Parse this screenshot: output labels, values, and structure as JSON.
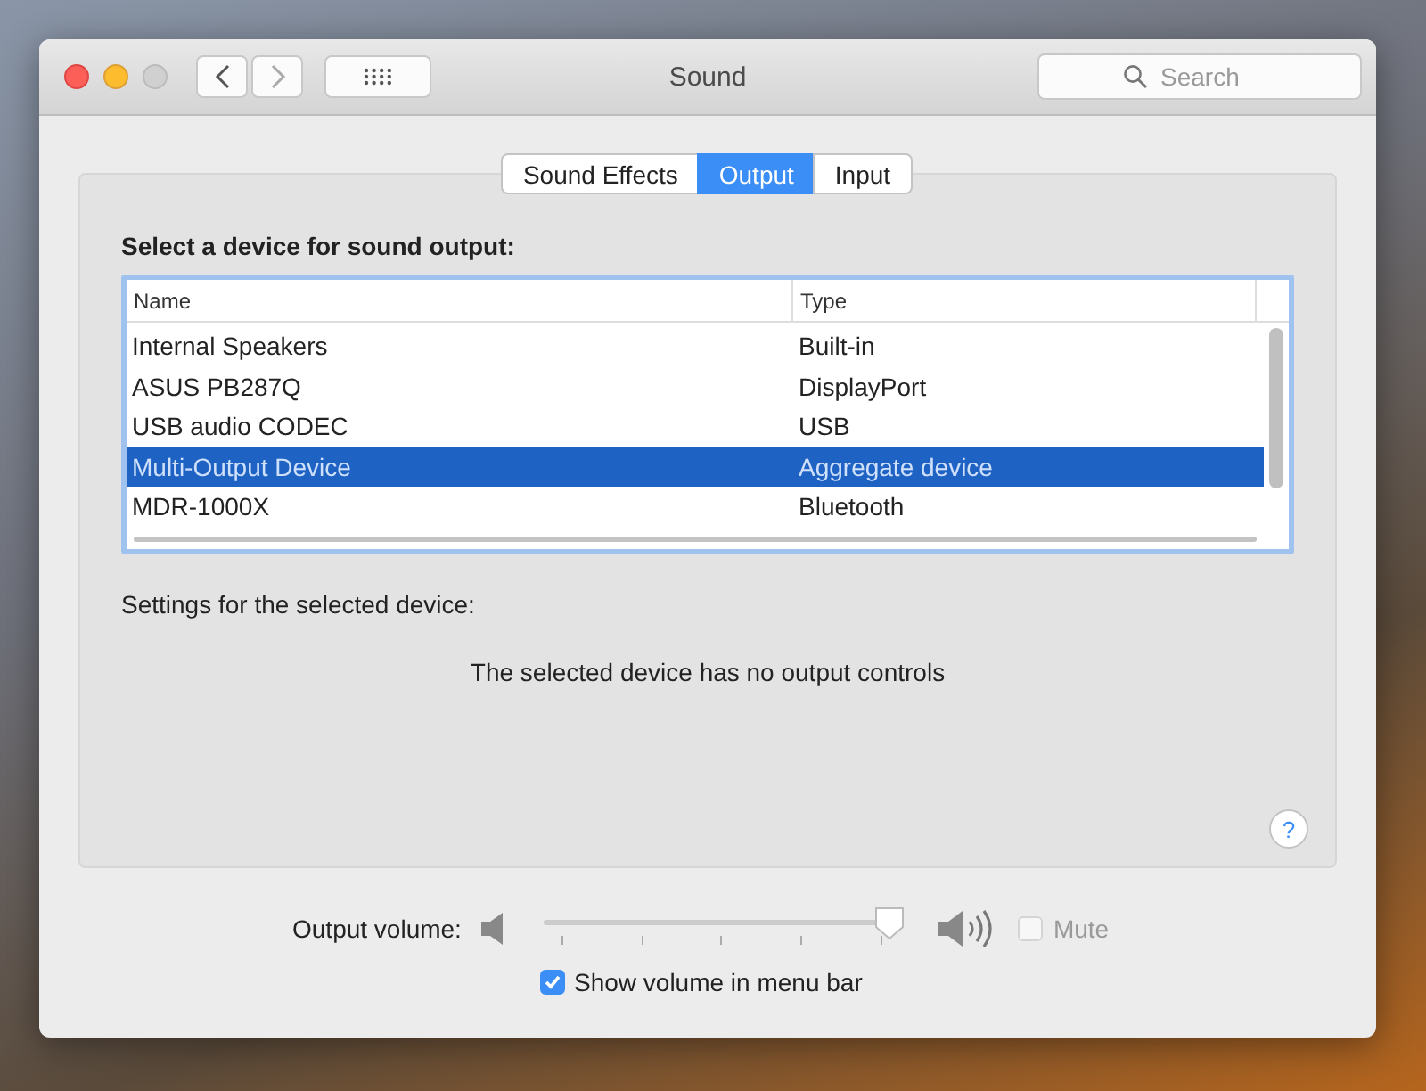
{
  "window": {
    "title": "Sound"
  },
  "search": {
    "placeholder": "Search"
  },
  "tabs": [
    {
      "label": "Sound Effects",
      "selected": false
    },
    {
      "label": "Output",
      "selected": true
    },
    {
      "label": "Input",
      "selected": false
    }
  ],
  "device_heading": "Select a device for sound output:",
  "table": {
    "columns": [
      "Name",
      "Type"
    ],
    "rows": [
      {
        "name": "Internal Speakers",
        "type": "Built-in",
        "selected": false
      },
      {
        "name": "ASUS PB287Q",
        "type": "DisplayPort",
        "selected": false
      },
      {
        "name": "USB audio CODEC",
        "type": "USB",
        "selected": false
      },
      {
        "name": "Multi-Output Device",
        "type": "Aggregate device",
        "selected": true
      },
      {
        "name": "MDR-1000X",
        "type": "Bluetooth",
        "selected": false
      }
    ]
  },
  "settings_label": "Settings for the selected device:",
  "no_controls_message": "The selected device has no output controls",
  "help_button": "?",
  "volume": {
    "label": "Output volume:",
    "level": 0.97,
    "mute": {
      "label": "Mute",
      "checked": false,
      "disabled": true
    }
  },
  "show_in_menu_bar": {
    "label": "Show volume in menu bar",
    "checked": true
  }
}
